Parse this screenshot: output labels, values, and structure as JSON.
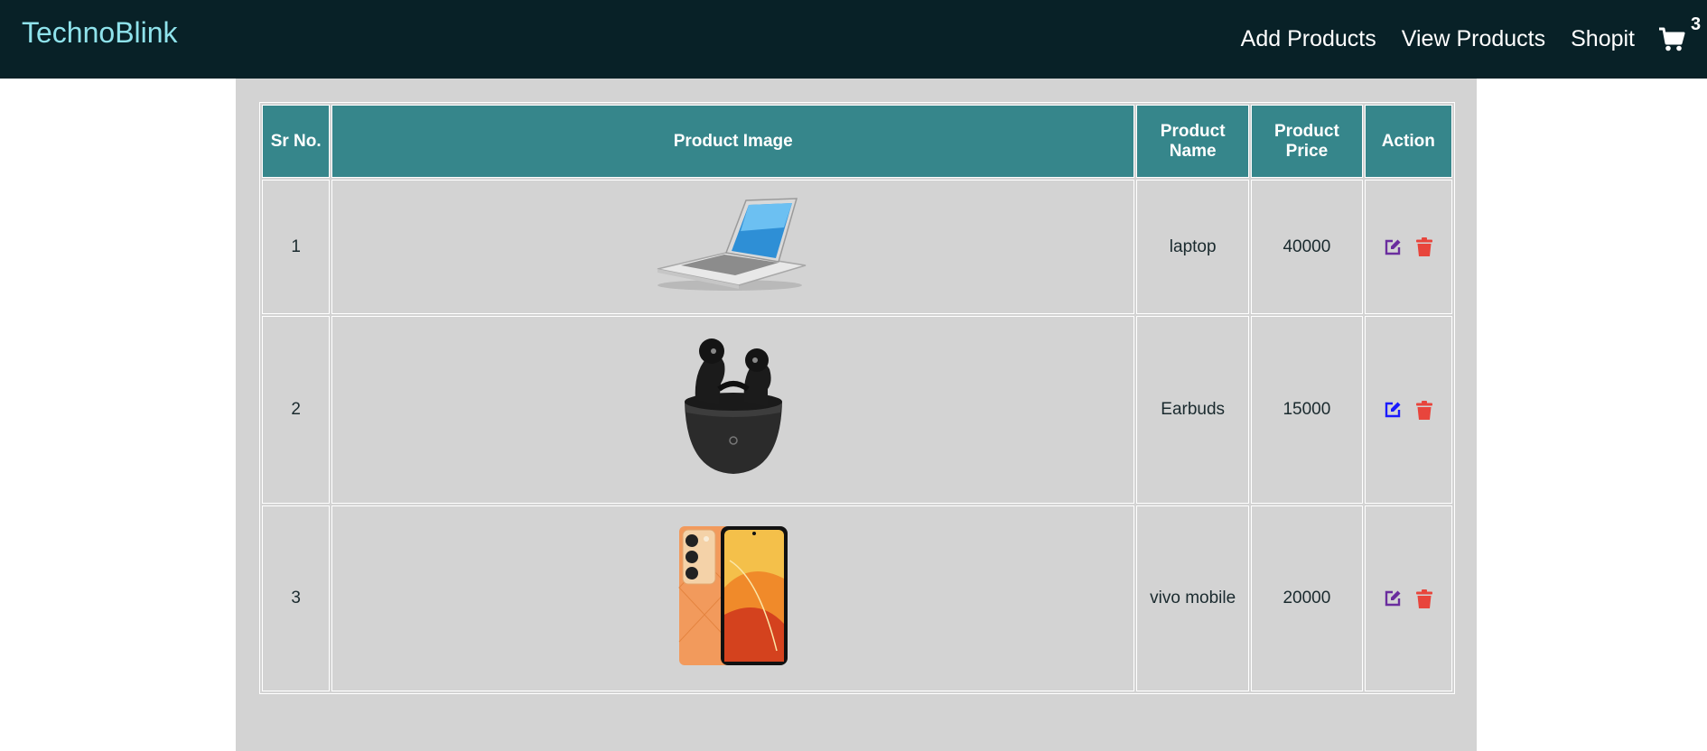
{
  "navbar": {
    "brand": "TechnoBlink",
    "links": [
      "Add Products",
      "View Products",
      "Shopit"
    ],
    "cart_count": "3",
    "cart_icon": "shopping-cart-icon",
    "background_color": "#082127",
    "brand_color": "#8fe3ec"
  },
  "table": {
    "header_color": "#36868b",
    "headers": {
      "sr": "Sr No.",
      "image": "Product Image",
      "name": "Product Name",
      "price": "Product Price",
      "action": "Action"
    },
    "rows": [
      {
        "sr": "1",
        "image_icon": "laptop-image",
        "name": "laptop",
        "price": "40000",
        "edit_color": "#6a2d9e"
      },
      {
        "sr": "2",
        "image_icon": "earbuds-image",
        "name": "Earbuds",
        "price": "15000",
        "edit_color": "#1a1aff"
      },
      {
        "sr": "3",
        "image_icon": "vivo-mobile-image",
        "name": "vivo mobile",
        "price": "20000",
        "edit_color": "#6a2d9e"
      }
    ],
    "delete_color": "#e8453c"
  }
}
